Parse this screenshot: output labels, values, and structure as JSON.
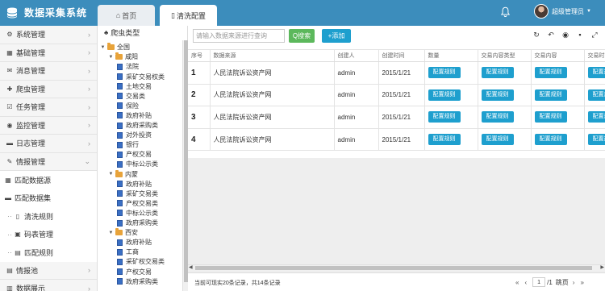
{
  "app": {
    "title": "数据采集系统"
  },
  "tabs": [
    {
      "icon": "home-icon",
      "label": "首页"
    },
    {
      "icon": "document-icon",
      "label": "清洗配置"
    }
  ],
  "user": {
    "name": "超级管理员"
  },
  "sidebar": {
    "items": [
      {
        "label": "系统管理",
        "icon": "gears-icon"
      },
      {
        "label": "基础管理",
        "icon": "table-icon"
      },
      {
        "label": "消息管理",
        "icon": "envelope-icon"
      },
      {
        "label": "爬虫管理",
        "icon": "puzzle-icon"
      },
      {
        "label": "任务管理",
        "icon": "tasks-icon"
      },
      {
        "label": "监控管理",
        "icon": "monitor-icon"
      },
      {
        "label": "日志管理",
        "icon": "book-icon"
      },
      {
        "label": "情报管理",
        "icon": "wrench-icon"
      }
    ],
    "sub_items": [
      {
        "label": "匹配数据源",
        "icon": "table-icon"
      },
      {
        "label": "匹配数据集",
        "icon": "truck-icon"
      }
    ],
    "sub2_items": [
      {
        "label": "清洗规则",
        "icon": "file-icon"
      },
      {
        "label": "码表管理",
        "icon": "box-icon"
      },
      {
        "label": "匹配规则",
        "icon": "list-icon"
      }
    ],
    "bottom_items": [
      {
        "label": "情报池",
        "icon": "database-icon"
      },
      {
        "label": "数据展示",
        "icon": "chart-icon"
      }
    ]
  },
  "tree": {
    "title": "爬虫类型",
    "nodes": [
      {
        "label": "全国",
        "type": "folder",
        "level": 0
      },
      {
        "label": "咸阳",
        "type": "folder",
        "level": 1
      },
      {
        "label": "法院",
        "type": "doc",
        "level": 2
      },
      {
        "label": "采矿交易权类",
        "type": "doc",
        "level": 2
      },
      {
        "label": "土地交易",
        "type": "doc",
        "level": 2
      },
      {
        "label": "交易类",
        "type": "doc",
        "level": 2
      },
      {
        "label": "保险",
        "type": "doc",
        "level": 2
      },
      {
        "label": "政府补贴",
        "type": "doc",
        "level": 2
      },
      {
        "label": "政府采购类",
        "type": "doc",
        "level": 2
      },
      {
        "label": "对外投资",
        "type": "doc",
        "level": 2
      },
      {
        "label": "银行",
        "type": "doc",
        "level": 2
      },
      {
        "label": "产权交易",
        "type": "doc",
        "level": 2
      },
      {
        "label": "中标公示类",
        "type": "doc",
        "level": 2
      },
      {
        "label": "内蒙",
        "type": "folder",
        "level": 1
      },
      {
        "label": "政府补贴",
        "type": "doc",
        "level": 2
      },
      {
        "label": "采矿交易类",
        "type": "doc",
        "level": 2
      },
      {
        "label": "产权交易类",
        "type": "doc",
        "level": 2
      },
      {
        "label": "中标公示类",
        "type": "doc",
        "level": 2
      },
      {
        "label": "政府采购类",
        "type": "doc",
        "level": 2
      },
      {
        "label": "西安",
        "type": "folder",
        "level": 1
      },
      {
        "label": "政府补贴",
        "type": "doc",
        "level": 2
      },
      {
        "label": "工商",
        "type": "doc",
        "level": 2
      },
      {
        "label": "采矿权交易类",
        "type": "doc",
        "level": 2
      },
      {
        "label": "产权交易",
        "type": "doc",
        "level": 2
      },
      {
        "label": "政府采购类",
        "type": "doc",
        "level": 2
      }
    ]
  },
  "search": {
    "placeholder": "请输入数据来源进行查询",
    "button": "Q搜索"
  },
  "add_button": "+添加",
  "toolbar_icons": [
    "refresh-icon",
    "undo-icon",
    "eye-icon",
    "lock-icon",
    "expand-icon"
  ],
  "table": {
    "columns": [
      "序号",
      "数据来源",
      "创建人",
      "创建时间",
      "数量",
      "交易内容类型",
      "交易内容",
      "交易时间"
    ],
    "rows": [
      {
        "no": "1",
        "source": "人民法院诉讼资产网",
        "creator": "admin",
        "time": "2015/1/21"
      },
      {
        "no": "2",
        "source": "人民法院诉讼资产网",
        "creator": "admin",
        "time": "2015/1/21"
      },
      {
        "no": "3",
        "source": "人民法院诉讼资产网",
        "creator": "admin",
        "time": "2015/1/21"
      },
      {
        "no": "4",
        "source": "人民法院诉讼资产网",
        "creator": "admin",
        "time": "2015/1/21"
      }
    ],
    "config_label": "配置规则"
  },
  "footer": {
    "info": "当前可现实20条记录，共14条记录",
    "page_current": "1",
    "page_total": "/1",
    "page_suffix": "跳页",
    "first": "«",
    "prev": "‹",
    "next": "›",
    "last": "»"
  }
}
